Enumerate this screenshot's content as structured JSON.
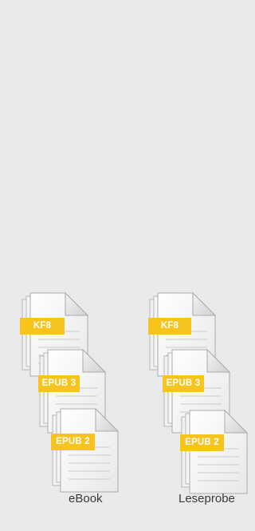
{
  "columns": [
    {
      "label": "eBook",
      "files": [
        {
          "format": "KF8"
        },
        {
          "format": "EPUB 3"
        },
        {
          "format": "EPUB 2"
        }
      ]
    },
    {
      "label": "Leseprobe",
      "files": [
        {
          "format": "KF8"
        },
        {
          "format": "EPUB 3"
        },
        {
          "format": "EPUB 2"
        }
      ]
    }
  ],
  "colors": {
    "background": "#e9eaeb",
    "badge": "#f7c31d",
    "badge_text": "#ffffff",
    "label_text": "#3a3a3a"
  },
  "icons": [
    "document-stack-icon"
  ]
}
